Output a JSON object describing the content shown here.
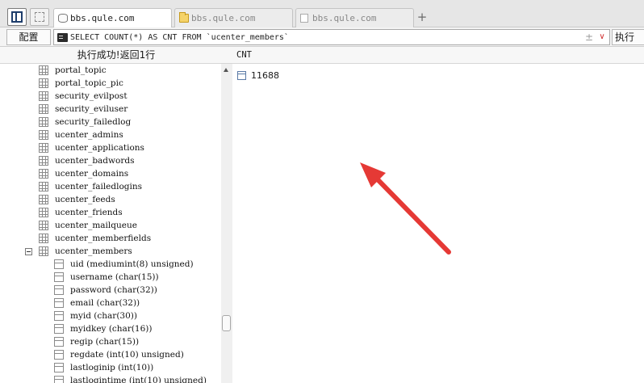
{
  "tabs": [
    {
      "label": "bbs.qule.com",
      "icon": "database-icon",
      "active": true
    },
    {
      "label": "bbs.qule.com",
      "icon": "folder-icon",
      "active": false
    },
    {
      "label": "bbs.qule.com",
      "icon": "document-icon",
      "active": false
    }
  ],
  "tab_add_symbol": "+",
  "toolbar": {
    "config_label": "配置",
    "sql_value": "SELECT COUNT(*) AS CNT FROM `ucenter_members`",
    "plus_minus_symbol": "±",
    "dropdown_symbol": "∨",
    "run_label": "执行"
  },
  "left_panel": {
    "status_text": "执行成功!返回1行",
    "tables": [
      "portal_topic",
      "portal_topic_pic",
      "security_evilpost",
      "security_eviluser",
      "security_failedlog",
      "ucenter_admins",
      "ucenter_applications",
      "ucenter_badwords",
      "ucenter_domains",
      "ucenter_failedlogins",
      "ucenter_feeds",
      "ucenter_friends",
      "ucenter_mailqueue",
      "ucenter_memberfields",
      "ucenter_members"
    ],
    "expanded_columns": [
      "uid (mediumint(8) unsigned)",
      "username (char(15))",
      "password (char(32))",
      "email (char(32))",
      "myid (char(30))",
      "myidkey (char(16))",
      "regip (char(15))",
      "regdate (int(10) unsigned)",
      "lastloginip (int(10))",
      "lastlogintime (int(10) unsigned)"
    ]
  },
  "result": {
    "column_header": "CNT",
    "rows": [
      "11688"
    ]
  },
  "colors": {
    "annotation_arrow": "#e53935"
  }
}
